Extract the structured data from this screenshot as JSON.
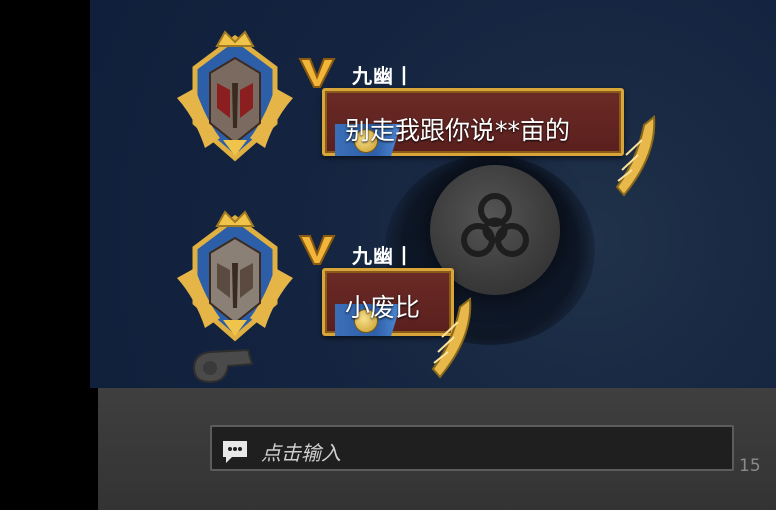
{
  "messages": [
    {
      "username": "九幽丨",
      "text": "别走我跟你说**亩的"
    },
    {
      "username": "九幽丨",
      "text": "小废比"
    }
  ],
  "input": {
    "placeholder": "点击输入",
    "counter": "15"
  },
  "colors": {
    "bubble": "#5a201e",
    "bubble_border": "#d8a53a",
    "background": "#142440"
  },
  "icons": [
    "rank-avatar-icon",
    "vip-badge-icon",
    "biohazard-emblem-icon",
    "wing-icon",
    "whistle-icon",
    "chat-bubble-icon"
  ]
}
